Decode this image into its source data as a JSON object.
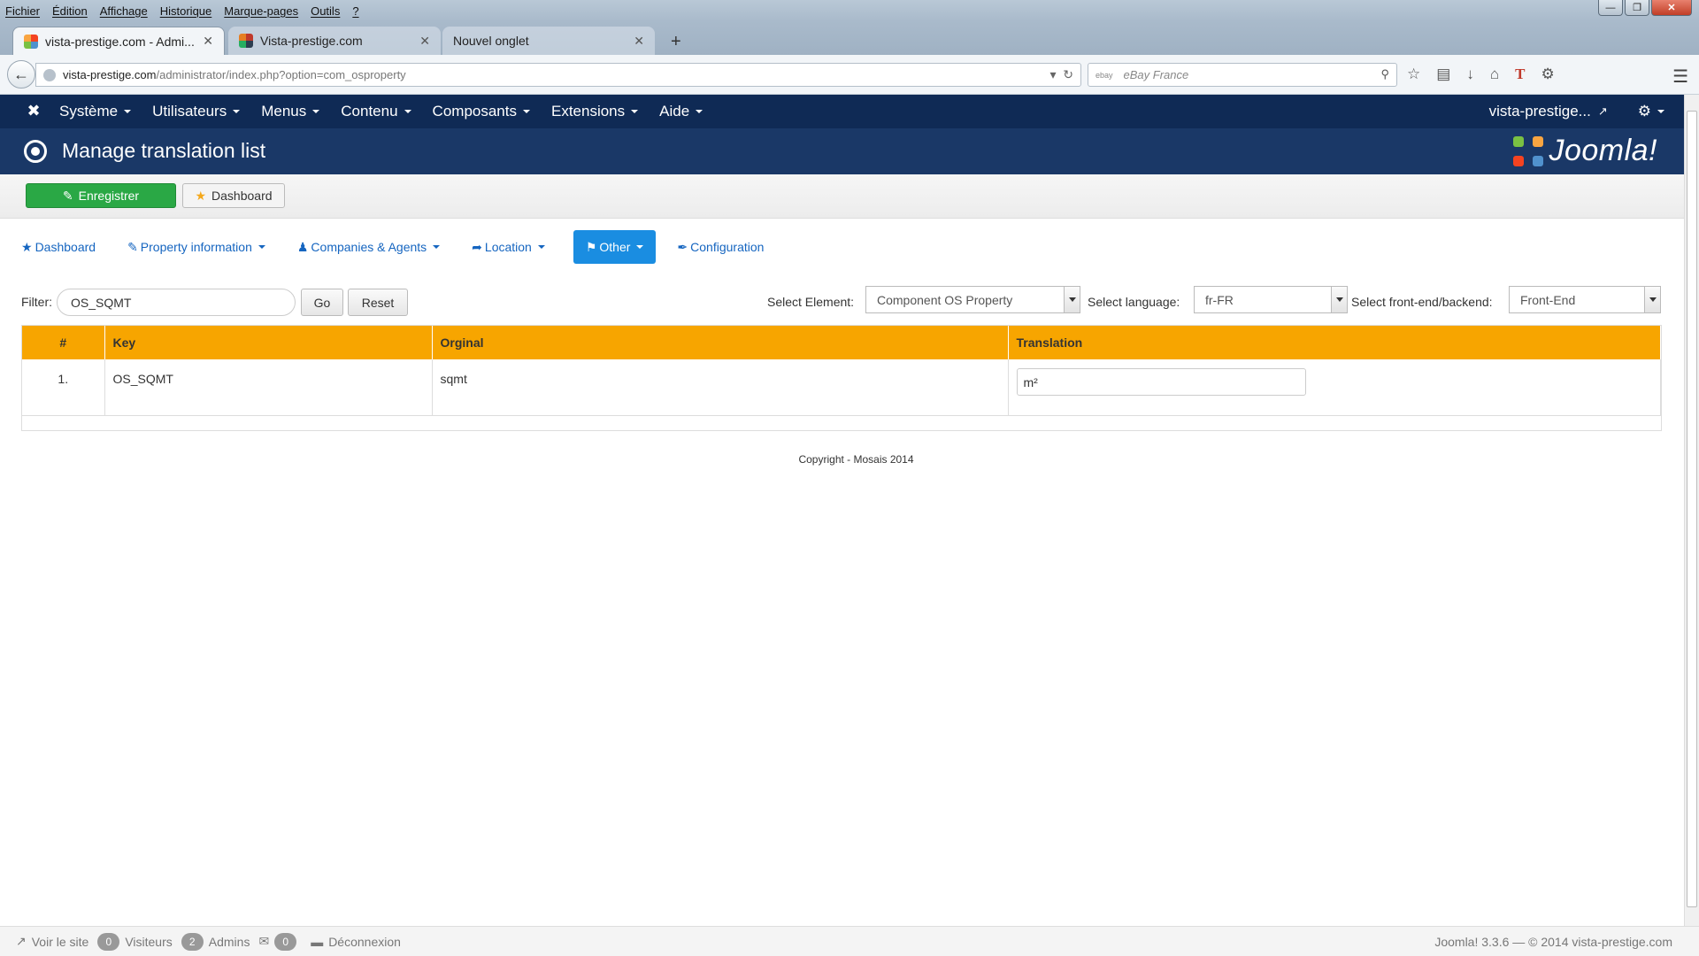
{
  "browser": {
    "menu": [
      "Fichier",
      "Édition",
      "Affichage",
      "Historique",
      "Marque-pages",
      "Outils",
      "?"
    ],
    "tabs": [
      {
        "title": "vista-prestige.com - Admi...",
        "active": true
      },
      {
        "title": "Vista-prestige.com",
        "active": false
      },
      {
        "title": "Nouvel onglet",
        "active": false
      }
    ],
    "url_host": "vista-prestige.com",
    "url_path": "/administrator/index.php?option=com_osproperty",
    "search_placeholder": "eBay France",
    "search_engine_label": "ebay"
  },
  "joomla": {
    "menu": [
      "Système",
      "Utilisateurs",
      "Menus",
      "Contenu",
      "Composants",
      "Extensions",
      "Aide"
    ],
    "site_label": "vista-prestige...",
    "page_title": "Manage translation list",
    "brand": "Joomla!",
    "toolbar": {
      "save_label": "Enregistrer",
      "dashboard_label": "Dashboard"
    }
  },
  "subnav": {
    "dashboard": "Dashboard",
    "property_information": "Property information",
    "companies_agents": "Companies & Agents",
    "location": "Location",
    "other": "Other",
    "configuration": "Configuration"
  },
  "filter": {
    "label": "Filter:",
    "value": "OS_SQMT",
    "go_label": "Go",
    "reset_label": "Reset",
    "select_element_label": "Select Element:",
    "select_element_value": "Component OS Property",
    "select_language_label": "Select language:",
    "select_language_value": "fr-FR",
    "select_side_label": "Select front-end/backend:",
    "select_side_value": "Front-End"
  },
  "table": {
    "headers": {
      "num": "#",
      "key": "Key",
      "original": "Orginal",
      "translation": "Translation"
    },
    "rows": [
      {
        "num": "1.",
        "key": "OS_SQMT",
        "original": "sqmt",
        "translation": "m²"
      }
    ]
  },
  "footer": {
    "copyright": "Copyright - Mosais 2014"
  },
  "statusbar": {
    "view_site": "Voir le site",
    "visitors_count": "0",
    "visitors_label": "Visiteurs",
    "admins_count": "2",
    "admins_label": "Admins",
    "messages_count": "0",
    "logout": "Déconnexion",
    "version_info": "Joomla! 3.3.6 — © 2014 vista-prestige.com"
  },
  "colors": {
    "nav_bg": "#0f2a55",
    "header_bg": "#1a3867",
    "save_green": "#2aa845",
    "table_header": "#f7a500",
    "subnav_active": "#1a8de1",
    "link_blue": "#1565c0"
  }
}
